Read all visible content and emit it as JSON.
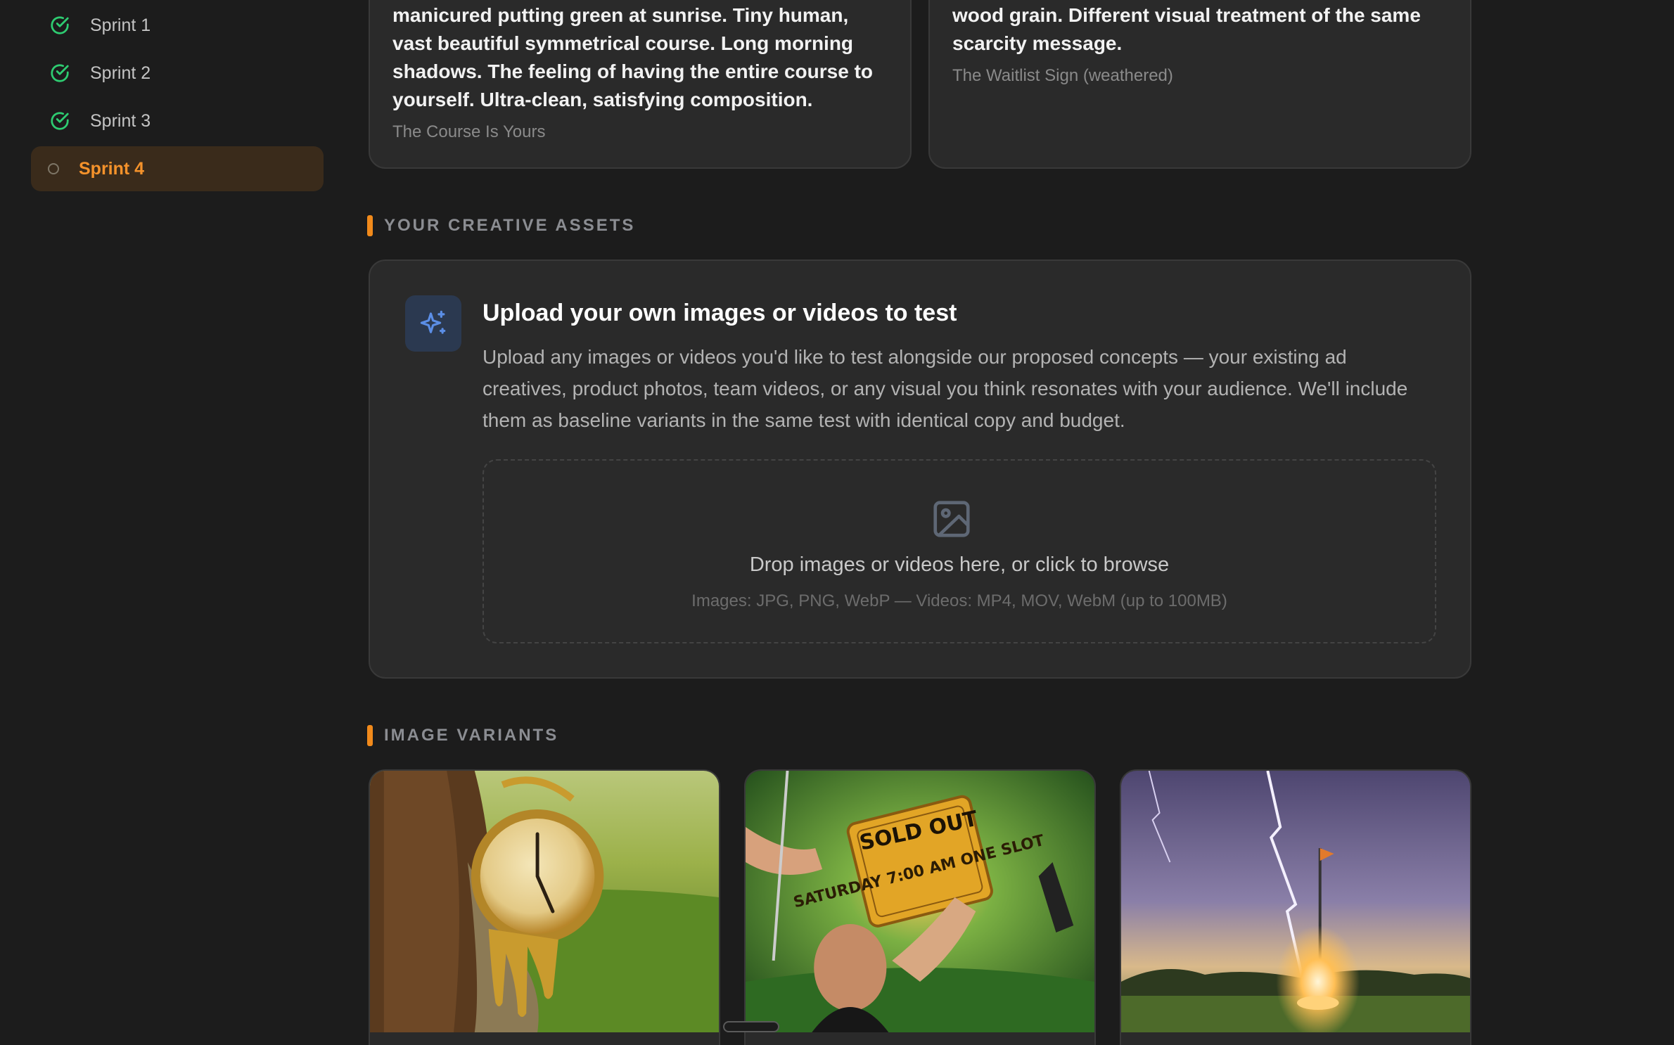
{
  "sidebar": {
    "sprints": [
      {
        "label": "Sprint 1",
        "status": "complete"
      },
      {
        "label": "Sprint 2",
        "status": "complete"
      },
      {
        "label": "Sprint 3",
        "status": "complete"
      },
      {
        "label": "Sprint 4",
        "status": "active"
      }
    ]
  },
  "concepts": [
    {
      "description": "manicured putting green at sunrise. Tiny human, vast beautiful symmetrical course. Long morning shadows. The feeling of having the entire course to yourself. Ultra-clean, satisfying composition.",
      "title": "The Course Is Yours"
    },
    {
      "description": "wood grain. Different visual treatment of the same scarcity message.",
      "title": "The Waitlist Sign (weathered)"
    }
  ],
  "creative_assets": {
    "section_title": "YOUR CREATIVE ASSETS",
    "icon": "sparkle-icon",
    "title": "Upload your own images or videos to test",
    "text": "Upload any images or videos you'd like to test alongside our proposed concepts — your existing ad creatives, product photos, team videos, or any visual you think resonates with your audience. We'll include them as baseline variants in the same test with identical copy and budget.",
    "dropzone": {
      "icon": "image-icon",
      "title": "Drop images or videos here, or click to browse",
      "subtitle": "Images: JPG, PNG, WebP — Videos: MP4, MOV, WebM (up to 100MB)"
    }
  },
  "image_variants": {
    "section_title": "IMAGE VARIANTS",
    "items": [
      {
        "image_text": ""
      },
      {
        "image_text": "SOLD OUT",
        "image_text_2": "SATURDAY 7:00 AM ONE SLOT"
      },
      {
        "image_text": ""
      }
    ]
  },
  "colors": {
    "accent": "#f18a1b",
    "success": "#2ecc71",
    "background": "#1c1c1c",
    "card": "#2a2a2a"
  }
}
